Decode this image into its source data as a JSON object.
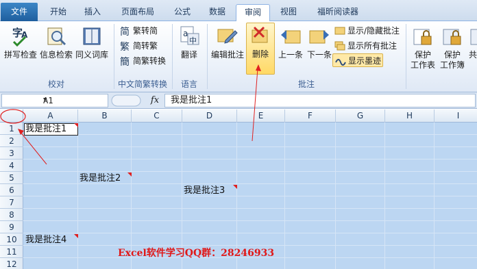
{
  "tabs": [
    {
      "label": "文件"
    },
    {
      "label": "开始"
    },
    {
      "label": "插入"
    },
    {
      "label": "页面布局"
    },
    {
      "label": "公式"
    },
    {
      "label": "数据"
    },
    {
      "label": "审阅"
    },
    {
      "label": "视图"
    },
    {
      "label": "福昕阅读器"
    }
  ],
  "ribbon": {
    "proofing": {
      "spell": "拼写检查",
      "research": "信息检索",
      "thesaurus": "同义词库",
      "label": "校对"
    },
    "chinese": {
      "to_simplified": "繁转简",
      "to_traditional": "简转繁",
      "convert": "简繁转换",
      "label": "中文简繁转换"
    },
    "language": {
      "translate": "翻译",
      "label": "语言"
    },
    "comments": {
      "edit": "编辑批注",
      "delete": "删除",
      "prev": "上一条",
      "next": "下一条",
      "show_hide": "显示/隐藏批注",
      "show_all": "显示所有批注",
      "show_ink": "显示墨迹",
      "label": "批注"
    },
    "changes": {
      "protect_sheet": "保护\n工作表",
      "protect_workbook": "保护\n工作簿",
      "share": "共"
    }
  },
  "formula_bar": {
    "name_box": "A1",
    "fx": "fx",
    "content": "我是批注1"
  },
  "columns": [
    "A",
    "B",
    "C",
    "D",
    "E",
    "F",
    "G",
    "H",
    "I"
  ],
  "rows": [
    "1",
    "2",
    "3",
    "4",
    "5",
    "6",
    "7",
    "8",
    "9",
    "10",
    "11",
    "12"
  ],
  "cells": {
    "a1": "我是批注1",
    "b5": "我是批注2",
    "d6": "我是批注3",
    "a10": "我是批注4"
  },
  "overlay_text": "Excel软件学习QQ群：28246933",
  "colors": {
    "accent_red": "#e02020",
    "selection": "#bcd6f2",
    "file_tab": "#2b71b4"
  }
}
